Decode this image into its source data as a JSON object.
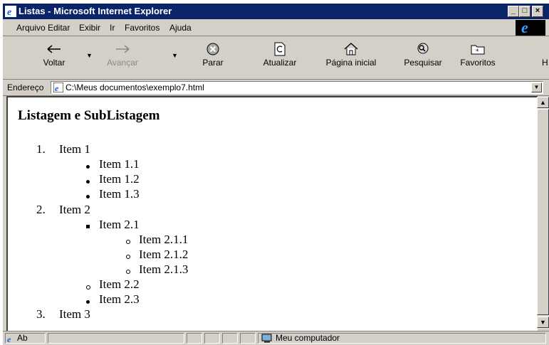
{
  "window": {
    "title": "Listas - Microsoft Internet Explorer"
  },
  "menu": {
    "items": [
      "Arquivo",
      "Editar",
      "Exibir",
      "Ir",
      "Favoritos",
      "Ajuda"
    ]
  },
  "toolbar": {
    "back": "Voltar",
    "forward": "Avançar",
    "stop": "Parar",
    "refresh": "Atualizar",
    "home": "Página inicial",
    "search": "Pesquisar",
    "favorites": "Favoritos"
  },
  "address": {
    "label": "Endereço",
    "value": "C:\\Meus documentos\\exemplo7.html"
  },
  "page": {
    "heading": "Listagem e SubListagem",
    "list": {
      "item1": {
        "number": "1.",
        "label": "Item 1",
        "children": [
          "Item 1.1",
          "Item 1.2",
          "Item 1.3"
        ]
      },
      "item2": {
        "number": "2.",
        "label": "Item 2",
        "child1": {
          "label": "Item 2.1",
          "children": [
            "Item 2.1.1",
            "Item 2.1.2",
            "Item 2.1.3"
          ]
        },
        "child2": "Item 2.2",
        "child3": "Item 2.3"
      },
      "item3": {
        "number": "3.",
        "label": "Item 3"
      }
    }
  },
  "status": {
    "left": "Ab",
    "zone": "Meu computador"
  },
  "colors": {
    "titlebar": "#0a246a",
    "chrome": "#d4d0c8"
  }
}
